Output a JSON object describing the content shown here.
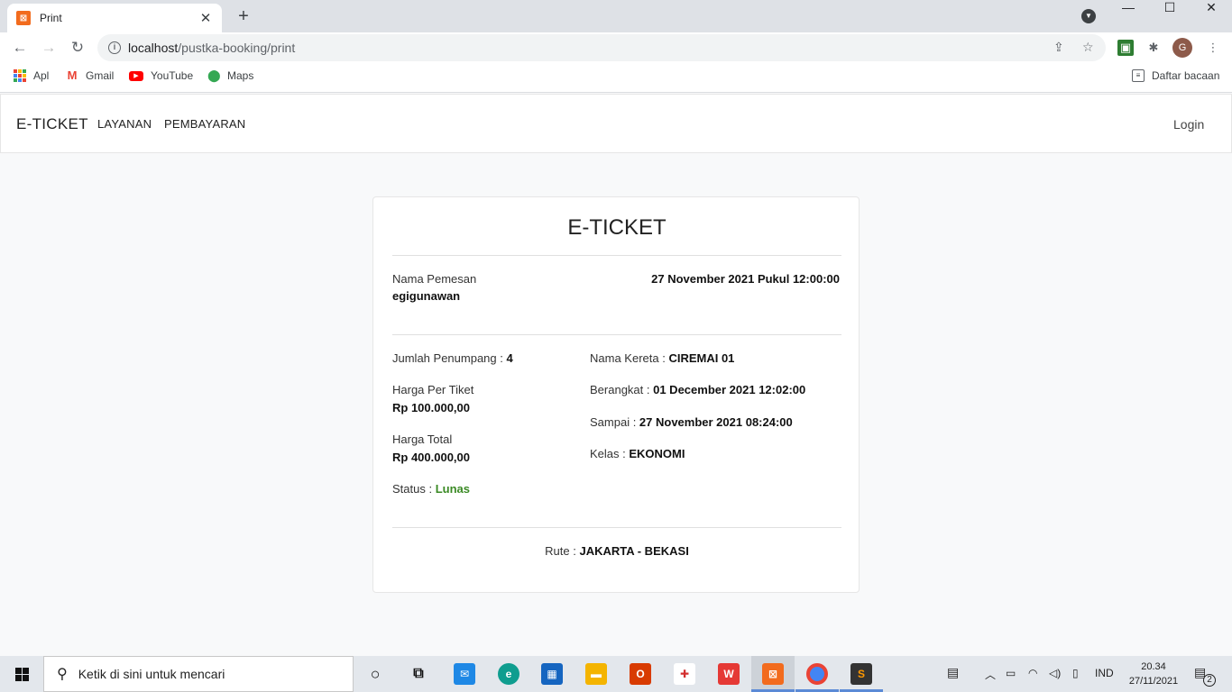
{
  "browser": {
    "tab_title": "Print",
    "tab_close": "✕",
    "new_tab": "+",
    "url_host": "localhost",
    "url_path": "/pustka-booking/print",
    "bookmarks": [
      {
        "label": "Apl",
        "icon": "apps-icon"
      },
      {
        "label": "Gmail",
        "icon": "gmail-icon"
      },
      {
        "label": "YouTube",
        "icon": "youtube-icon"
      },
      {
        "label": "Maps",
        "icon": "maps-icon"
      }
    ],
    "reading_list": "Daftar bacaan",
    "profile_initial": "G"
  },
  "nav": {
    "brand": "E-TICKET",
    "links": [
      "LAYANAN",
      "PEMBAYARAN"
    ],
    "login": "Login"
  },
  "ticket": {
    "title": "E-TICKET",
    "customer_label": "Nama Pemesan",
    "customer_name": "egigunawan",
    "datetime": "27 November 2021 Pukul 12:00:00",
    "passengers_label": "Jumlah Penumpang : ",
    "passengers_value": "4",
    "price_label": "Harga Per Tiket",
    "price_value": "Rp 100.000,00",
    "total_label": "Harga Total",
    "total_value": "Rp 400.000,00",
    "status_label": "Status : ",
    "status_value": "Lunas",
    "train_label": "Nama Kereta : ",
    "train_value": "CIREMAI 01",
    "depart_label": "Berangkat : ",
    "depart_value": "01 December 2021 12:02:00",
    "arrive_label": "Sampai : ",
    "arrive_value": "27 November 2021 08:24:00",
    "class_label": "Kelas : ",
    "class_value": "EKONOMI",
    "route_label": "Rute : ",
    "route_value": "JAKARTA - BEKASI"
  },
  "taskbar": {
    "search_placeholder": "Ketik di sini untuk mencari",
    "language": "IND",
    "time": "20.34",
    "date": "27/11/2021",
    "notification_count": "2"
  },
  "colors": {
    "status_green": "#3a8a24",
    "xampp_orange": "#f26b1d"
  }
}
